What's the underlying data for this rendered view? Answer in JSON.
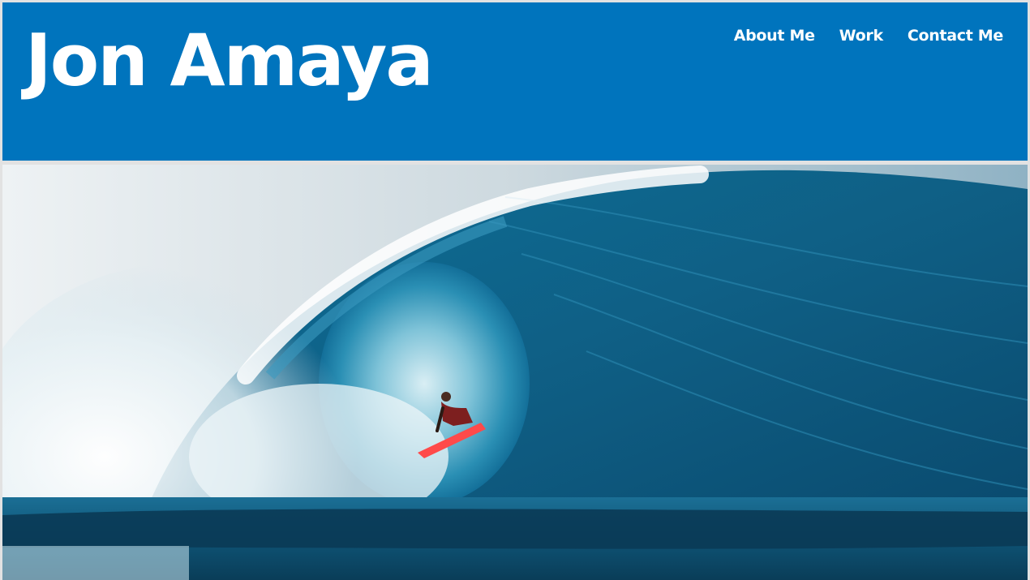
{
  "site": {
    "title": "Jon Amaya"
  },
  "nav": {
    "items": [
      {
        "label": "About Me"
      },
      {
        "label": "Work"
      },
      {
        "label": "Contact Me"
      }
    ]
  },
  "hero": {
    "image_subject": "surfer riding inside a barreling blue ocean wave"
  },
  "colors": {
    "header_background": "#0074bd",
    "header_text": "#ffffff",
    "surfboard": "#ff4a4a"
  }
}
